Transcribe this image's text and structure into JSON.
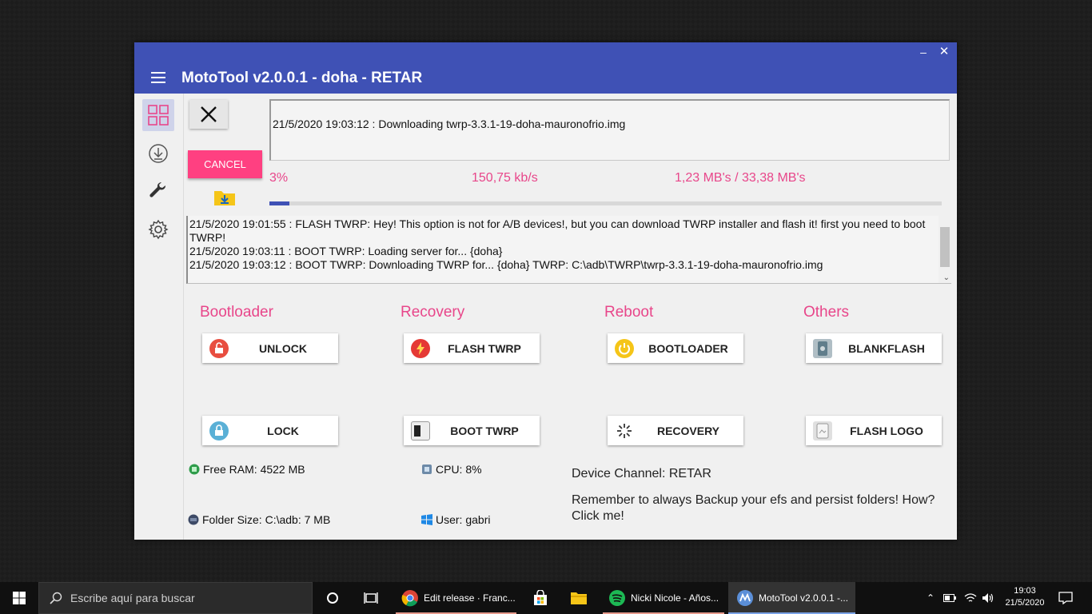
{
  "window": {
    "title": "MotoTool v2.0.0.1 - doha - RETAR",
    "minimize_glyph": "–",
    "close_glyph": "✕"
  },
  "colors": {
    "primary": "#3f51b5",
    "accent": "#ff4081",
    "pink_text": "#e8468a"
  },
  "sidebar": {
    "items": [
      {
        "icon": "dashboard-grid-icon",
        "active": true
      },
      {
        "icon": "download-icon",
        "active": false
      },
      {
        "icon": "wrench-icon",
        "active": false
      },
      {
        "icon": "gear-icon",
        "active": false
      }
    ]
  },
  "download": {
    "cancel_label": "CANCEL",
    "status_line": "21/5/2020 19:03:12 : Downloading twrp-3.3.1-19-doha-mauronofrio.img",
    "percent_text": "3%",
    "progress": 0.03,
    "speed": "150,75 kb/s",
    "size": "1,23 MB's / 33,38 MB's"
  },
  "log": {
    "lines": [
      "21/5/2020 19:01:55 : FLASH TWRP: Hey! This option is not for A/B devices!, but you can download TWRP installer and flash it! first you need to boot TWRP!",
      "21/5/2020 19:03:11 : BOOT TWRP: Loading server for... {doha}",
      "21/5/2020 19:03:12 : BOOT TWRP: Downloading TWRP for... {doha} TWRP: C:\\adb\\TWRP\\twrp-3.3.1-19-doha-mauronofrio.img"
    ]
  },
  "sections": {
    "bootloader": {
      "title": "Bootloader",
      "buttons": [
        "UNLOCK",
        "LOCK"
      ]
    },
    "recovery": {
      "title": "Recovery",
      "buttons": [
        "FLASH TWRP",
        "BOOT TWRP"
      ]
    },
    "reboot": {
      "title": "Reboot",
      "buttons": [
        "BOOTLOADER",
        "RECOVERY"
      ]
    },
    "others": {
      "title": "Others",
      "buttons": [
        "BLANKFLASH",
        "FLASH LOGO"
      ]
    }
  },
  "info": {
    "free_ram": "Free RAM: 4522 MB",
    "cpu": "CPU: 8%",
    "folder_size": "Folder Size: C:\\adb: 7 MB",
    "user": "User: gabri",
    "device_channel": "Device Channel: RETAR",
    "backup_note": "Remember to always Backup your efs and persist folders! How? Click me!"
  },
  "taskbar": {
    "search_placeholder": "Escribe aquí para buscar",
    "apps": [
      {
        "label": "Edit release · Franc...",
        "icon": "chrome-icon"
      },
      {
        "label": "Nicki Nicole - Años...",
        "icon": "spotify-icon"
      },
      {
        "label": "MotoTool v2.0.0.1 -...",
        "icon": "motorola-icon",
        "active": true
      }
    ],
    "time": "19:03",
    "date": "21/5/2020"
  }
}
